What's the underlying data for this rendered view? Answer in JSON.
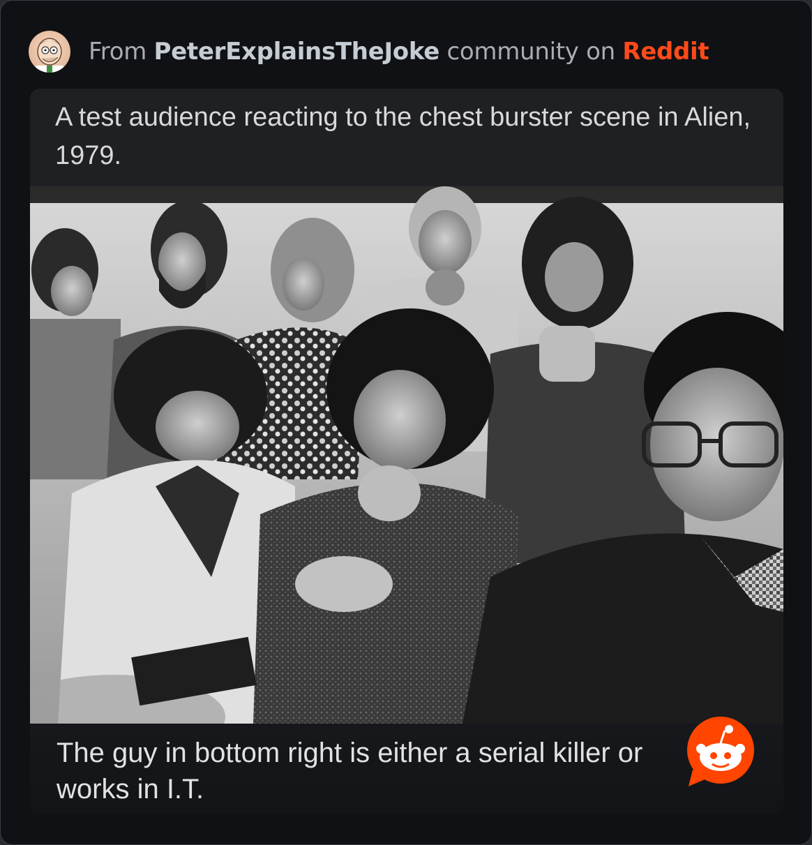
{
  "header": {
    "prefix": "From ",
    "community": "PeterExplainsTheJoke",
    "middle": " community on ",
    "platform": "Reddit",
    "avatar_icon": "peter-griffin-avatar-icon"
  },
  "post": {
    "caption_top": "A test audience reacting to the chest burster scene in Alien, 1979.",
    "caption_bottom": "The guy in bottom right is either a serial killer or works in I.T.",
    "photo_description_icon": "black-and-white-audience-photo",
    "logo_icon": "reddit-snoo-icon"
  },
  "colors": {
    "background": "#0f1114",
    "brand": "#ff4a1a",
    "community_text": "#c6ccd3",
    "muted_text": "#a9adb3"
  }
}
